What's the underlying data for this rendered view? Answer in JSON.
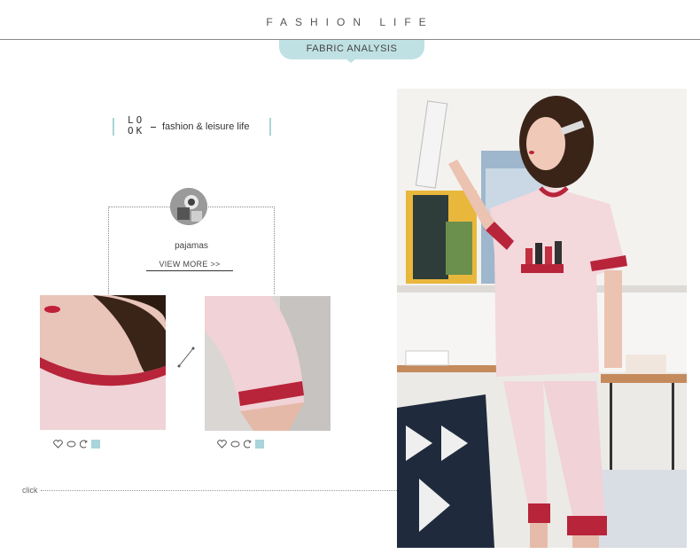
{
  "header": {
    "title": "FASHION LIFE",
    "tab_label": "FABRIC ANALYSIS"
  },
  "look": {
    "letters_top": "LO",
    "letters_bottom": "OK",
    "tagline": "fashion & leisure life"
  },
  "product": {
    "name": "pajamas",
    "view_more": "VIEW MORE >>"
  },
  "footer": {
    "click_label": "click"
  },
  "colors": {
    "accent": "#bfe1e4",
    "accent_dark": "#a9d4d9",
    "pink": "#f0d2d7",
    "red": "#b8243a"
  },
  "icons": [
    "heart-icon",
    "comment-icon",
    "share-icon",
    "square-icon"
  ]
}
